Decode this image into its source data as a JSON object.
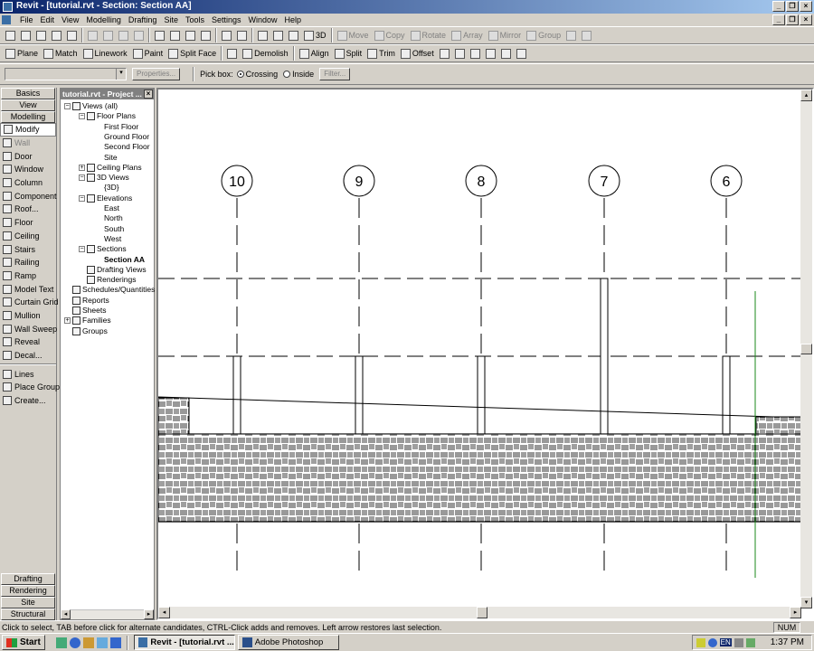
{
  "window": {
    "title": "Revit - [tutorial.rvt - Section: Section AA]"
  },
  "menu": [
    "File",
    "Edit",
    "View",
    "Modelling",
    "Drafting",
    "Site",
    "Tools",
    "Settings",
    "Window",
    "Help"
  ],
  "toolbar1": [
    {
      "name": "new-icon",
      "label": ""
    },
    {
      "name": "open-icon",
      "label": ""
    },
    {
      "name": "save-icon",
      "label": ""
    },
    {
      "name": "save-all-icon",
      "label": ""
    },
    {
      "name": "print-icon",
      "label": ""
    },
    {
      "name": "cut-icon",
      "label": ""
    },
    {
      "name": "copy-icon",
      "label": ""
    },
    {
      "name": "paste-icon",
      "label": ""
    },
    {
      "name": "delete-icon",
      "label": ""
    },
    {
      "name": "undo-icon",
      "label": ""
    },
    {
      "name": "undo-list-icon",
      "label": ""
    },
    {
      "name": "redo-icon",
      "label": ""
    },
    {
      "name": "redo-list-icon",
      "label": ""
    },
    {
      "name": "thin-lines-icon",
      "label": ""
    },
    {
      "name": "help-icon",
      "label": ""
    },
    {
      "name": "visibility-icon",
      "label": ""
    },
    {
      "name": "zoom-icon",
      "label": ""
    },
    {
      "name": "zoom-menu-icon",
      "label": ""
    },
    {
      "name": "3d-view-icon",
      "label": "3D"
    },
    {
      "name": "move-icon",
      "label": "Move"
    },
    {
      "name": "copy-tool-icon",
      "label": "Copy"
    },
    {
      "name": "rotate-icon",
      "label": "Rotate"
    },
    {
      "name": "array-icon",
      "label": "Array"
    },
    {
      "name": "mirror-icon",
      "label": "Mirror"
    },
    {
      "name": "group-icon",
      "label": "Group"
    },
    {
      "name": "lock-icon",
      "label": ""
    },
    {
      "name": "ungroup-icon",
      "label": ""
    }
  ],
  "toolbar2": [
    "Plane",
    "Match",
    "Linework",
    "Paint",
    "Split Face",
    "",
    "Demolish",
    "Align",
    "Split",
    "Trim",
    "Offset"
  ],
  "options": {
    "properties_label": "Properties...",
    "pick_box_label": "Pick box:",
    "crossing_label": "Crossing",
    "inside_label": "Inside",
    "filter_label": "Filter..."
  },
  "design_bar": {
    "tabs_top": [
      "Basics",
      "View",
      "Modelling"
    ],
    "tools": [
      "Modify",
      "Wall",
      "Door",
      "Window",
      "Column",
      "Component",
      "Roof...",
      "Floor",
      "Ceiling",
      "Stairs",
      "Railing",
      "Ramp",
      "Model Text",
      "Curtain Grid",
      "Mullion",
      "Wall Sweep",
      "Reveal",
      "Decal..."
    ],
    "tools2": [
      "Lines",
      "Place Group",
      "Create..."
    ],
    "tabs_bottom": [
      "Drafting",
      "Rendering",
      "Site",
      "Structural"
    ]
  },
  "project_browser": {
    "title": "tutorial.rvt - Project ...",
    "nodes": [
      {
        "label": "Views (all)",
        "lvl": 0,
        "pm": "−"
      },
      {
        "label": "Floor Plans",
        "lvl": 1,
        "pm": "−"
      },
      {
        "label": "First Floor",
        "lvl": 2
      },
      {
        "label": "Ground Floor",
        "lvl": 2
      },
      {
        "label": "Second Floor",
        "lvl": 2
      },
      {
        "label": "Site",
        "lvl": 2
      },
      {
        "label": "Ceiling Plans",
        "lvl": 1,
        "pm": "+"
      },
      {
        "label": "3D Views",
        "lvl": 1,
        "pm": "−"
      },
      {
        "label": "{3D}",
        "lvl": 2
      },
      {
        "label": "Elevations",
        "lvl": 1,
        "pm": "−"
      },
      {
        "label": "East",
        "lvl": 2
      },
      {
        "label": "North",
        "lvl": 2
      },
      {
        "label": "South",
        "lvl": 2
      },
      {
        "label": "West",
        "lvl": 2
      },
      {
        "label": "Sections",
        "lvl": 1,
        "pm": "−"
      },
      {
        "label": "Section AA",
        "lvl": 2,
        "sel": true
      },
      {
        "label": "Drafting Views",
        "lvl": 1
      },
      {
        "label": "Renderings",
        "lvl": 1
      },
      {
        "label": "Schedules/Quantities",
        "lvl": 0
      },
      {
        "label": "Reports",
        "lvl": 0
      },
      {
        "label": "Sheets",
        "lvl": 0
      },
      {
        "label": "Families",
        "lvl": 0,
        "pm": "+"
      },
      {
        "label": "Groups",
        "lvl": 0
      }
    ]
  },
  "grids": [
    "10",
    "9",
    "8",
    "7",
    "6"
  ],
  "status": {
    "hint": "Click to select, TAB before click for alternate candidates, CTRL-Click adds and removes. Left arrow restores last selection.",
    "num": "NUM"
  },
  "taskbar": {
    "start": "Start",
    "tasks": [
      "Revit - [tutorial.rvt ...",
      "Adobe Photoshop"
    ],
    "lang": "EN",
    "clock": "1:37 PM"
  }
}
